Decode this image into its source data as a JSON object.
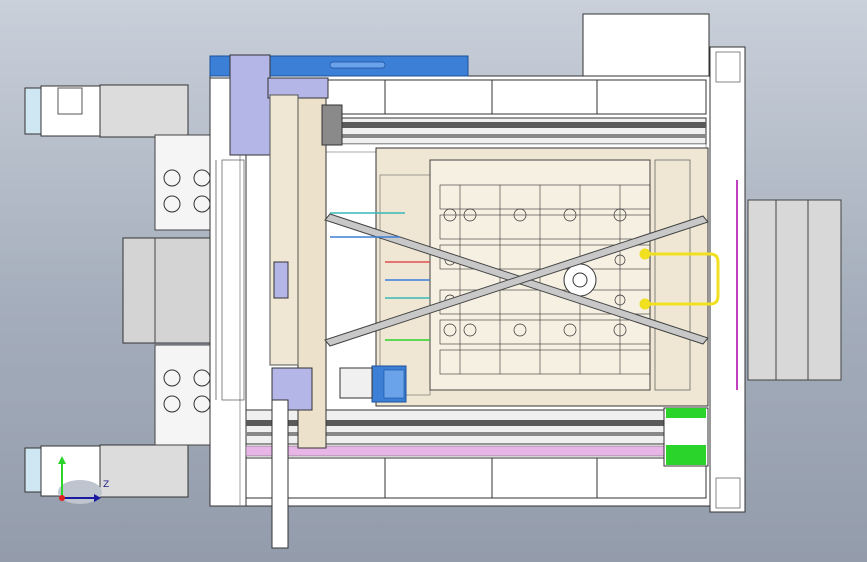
{
  "view": {
    "background_top": "#c9d0da",
    "background_bottom": "#939cab"
  },
  "colors": {
    "blue_rail": "#3b7fd6",
    "lavender": "#b4b6e8",
    "light_blue": "#cfe6f3",
    "tan": "#ece2cc",
    "yellow": "#f0e020",
    "green": "#2bd42b",
    "pink": "#e8b6e6",
    "beige": "#efe7d4",
    "dark_gray": "#4a4a4a"
  },
  "triad": {
    "axis_label": "Z"
  }
}
